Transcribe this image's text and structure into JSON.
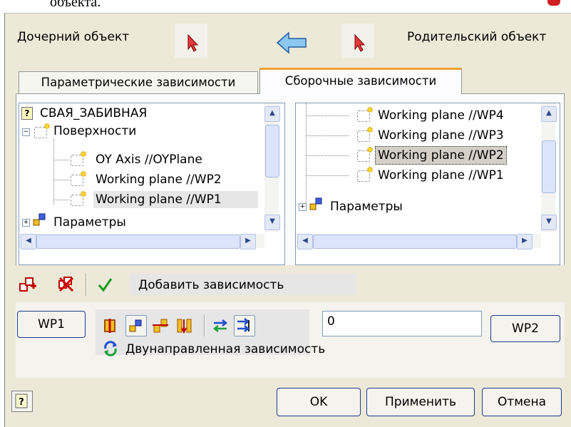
{
  "top_text": "объекта.",
  "child_label": "Дочерний объект",
  "parent_label": "Родительский объект",
  "tabs": [
    "Параметрические зависимости",
    "Сборочные зависимости"
  ],
  "left_tree": {
    "root": "СВАЯ_ЗАБИВНАЯ",
    "group": "Поверхности",
    "items": [
      "OY Axis //OYPlane",
      "Working plane //WP2",
      "Working plane //WP1"
    ],
    "params": "Параметры"
  },
  "right_tree": {
    "items": [
      "Working plane //WP4",
      "Working plane //WP3",
      "Working plane //WP2",
      "Working plane //WP1"
    ],
    "params": "Параметры"
  },
  "add_dependency": "Добавить зависимость",
  "wp1_button": "WP1",
  "wp2_button": "WP2",
  "offset_value": "0",
  "bidirectional": "Двунаправленная зависимость",
  "buttons": {
    "ok": "OK",
    "apply": "Применить",
    "cancel": "Отмена"
  },
  "colors": {
    "accent_tab": "#f0a030",
    "dialog_bg": "#ece9d8",
    "button_border": "#1e3c8c"
  }
}
